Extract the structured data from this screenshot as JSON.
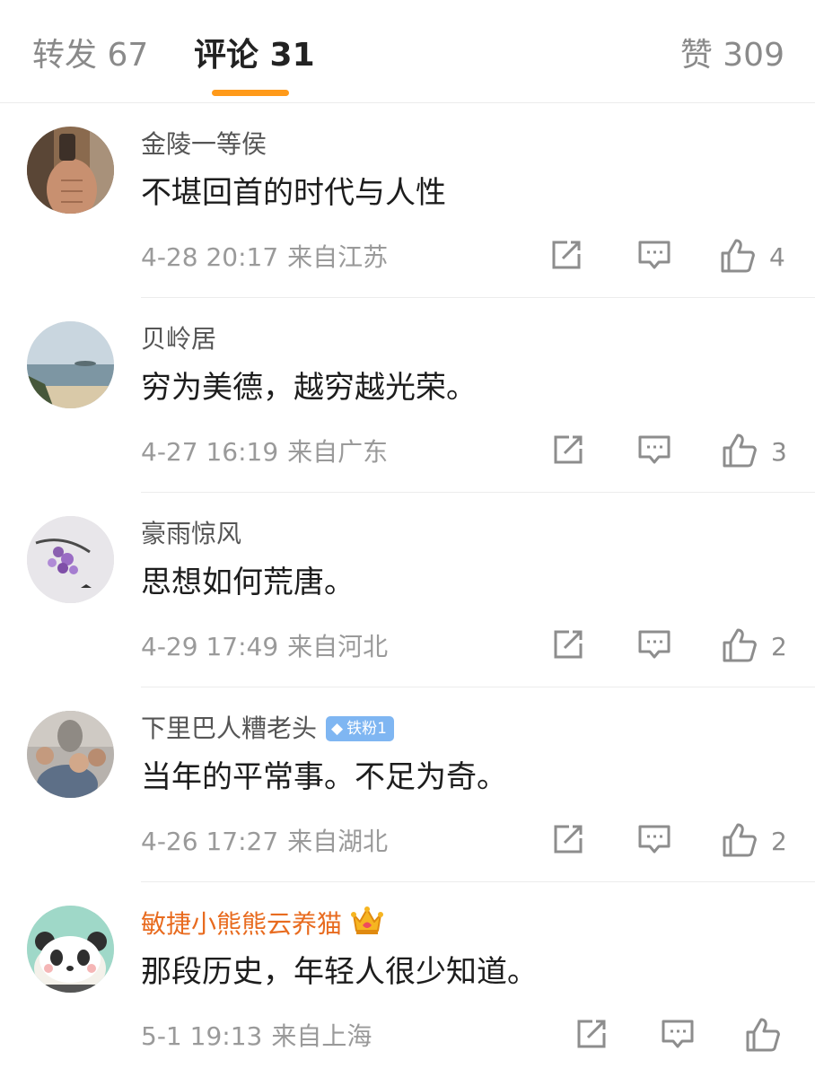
{
  "tabs": {
    "repost": "转发 67",
    "comment": "评论 31",
    "like": "赞 309"
  },
  "colors": {
    "accent": "#ff9a1a",
    "vip_name": "#e86b1f",
    "fan_badge": "#7fb6f2"
  },
  "comments": [
    {
      "user": "金陵一等侯",
      "text": "不堪回首的时代与人性",
      "time": "4-28 20:17",
      "location": "来自江苏",
      "likes": "4"
    },
    {
      "user": "贝岭居",
      "text": "穷为美德，越穷越光荣。",
      "time": "4-27 16:19",
      "location": "来自广东",
      "likes": "3"
    },
    {
      "user": "豪雨惊风",
      "text": "思想如何荒唐。",
      "time": "4-29 17:49",
      "location": "来自河北",
      "likes": "2"
    },
    {
      "user": "下里巴人糟老头",
      "badge": "铁粉1",
      "text": "当年的平常事。不足为奇。",
      "time": "4-26 17:27",
      "location": "来自湖北",
      "likes": "2"
    },
    {
      "user": "敏捷小熊熊云养猫",
      "text": "那段历史，年轻人很少知道。",
      "time": "5-1 19:13",
      "location": "来自上海",
      "likes": ""
    }
  ],
  "icons": [
    "repost-icon",
    "reply-icon",
    "thumbs-up-icon",
    "diamond-icon",
    "crown-icon"
  ]
}
